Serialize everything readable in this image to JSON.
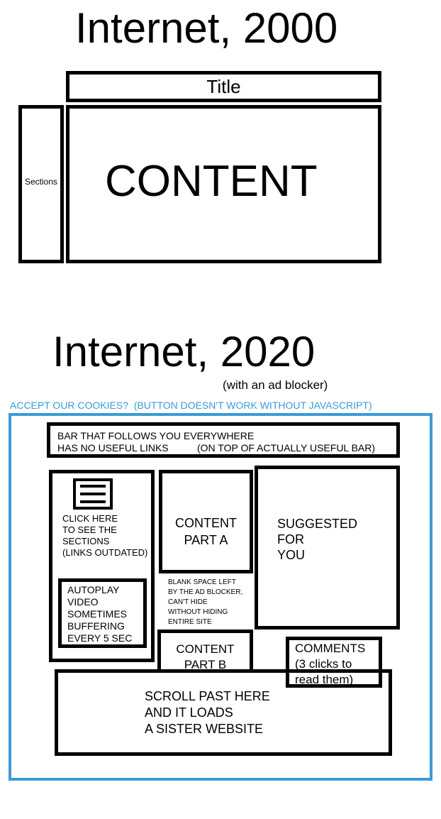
{
  "top": {
    "heading": "Internet, 2000",
    "title_box": "Title",
    "sections_box": "Sections",
    "content_box": "CONTENT"
  },
  "bottom": {
    "heading": "Internet, 2020",
    "subheading": "(with an ad blocker)",
    "cookie_notice": "ACCEPT OUR COOKIES?  (BUTTON DOESN'T WORK WITHOUT JAVASCRIPT)",
    "bar_text": "BAR THAT FOLLOWS YOU EVERYWHERE\nHAS NO USEFUL LINKS",
    "bar_note": "(ON TOP OF ACTUALLY USEFUL BAR)",
    "menu_text": "CLICK HERE\nTO SEE THE\nSECTIONS\n(LINKS OUTDATED)",
    "video_text": "AUTOPLAY\nVIDEO\nSOMETIMES\nBUFFERING\nEVERY 5 SEC",
    "content_a": "CONTENT\nPART A",
    "blank_space": "BLANK SPACE LEFT\nBY THE AD BLOCKER,\nCAN'T HIDE\nWITHOUT HIDING\nENTIRE SITE",
    "suggested": "SUGGESTED\nFOR\nYOU",
    "content_b": "CONTENT\nPART B",
    "comments": "COMMENTS\n(3 clicks to\nread them)",
    "sister_site": "SCROLL PAST HERE\nAND IT LOADS\nA SISTER WEBSITE"
  },
  "colors": {
    "frame_blue": "#3a9bd6",
    "line": "#000000",
    "background": "#ffffff"
  },
  "icons": [
    "hamburger-menu-icon"
  ]
}
